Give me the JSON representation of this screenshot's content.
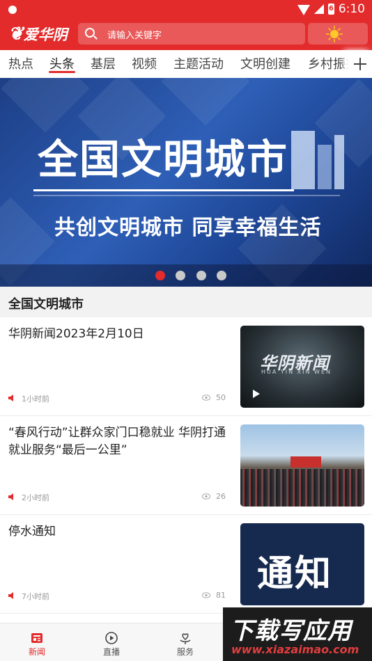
{
  "status_bar": {
    "time": "6:10",
    "battery_level": "6"
  },
  "header": {
    "logo_text": "爱华阴",
    "search_placeholder": "请输入关键字",
    "weather_icon": "sun-icon"
  },
  "tabs": [
    "热点",
    "头条",
    "基层",
    "视频",
    "主题活动",
    "文明创建",
    "乡村振兴"
  ],
  "active_tab": "头条",
  "banner": {
    "title": "全国文明城市",
    "subtitle": "共创文明城市 同享幸福生活",
    "slide_count": 4,
    "active_slide": 1
  },
  "section": {
    "title": "全国文明城市"
  },
  "news": [
    {
      "title": "华阴新闻2023年2月10日",
      "time": "1小时前",
      "views": "50",
      "thumb_text": "华阴新闻",
      "thumb_sub": "HUA YIN XIN WEN",
      "is_video": true
    },
    {
      "title": "“春风行动”让群众家门口稳就业 华阴打通就业服务“最后一公里”",
      "time": "2小时前",
      "views": "26",
      "thumb_text": "",
      "is_video": false
    },
    {
      "title": "停水通知",
      "time": "7小时前",
      "views": "81",
      "thumb_text": "通知",
      "is_video": false
    }
  ],
  "bottom_nav": [
    {
      "label": "新闻",
      "icon": "news-icon",
      "active": true
    },
    {
      "label": "直播",
      "icon": "play-circle-icon",
      "active": false
    },
    {
      "label": "服务",
      "icon": "heart-hand-icon",
      "active": false
    }
  ],
  "watermark": {
    "main": "下载写应用",
    "url": "www.xiazaimao.com"
  },
  "colors": {
    "brand_red": "#e32b2b",
    "banner_blue": "#2e5fb7"
  }
}
